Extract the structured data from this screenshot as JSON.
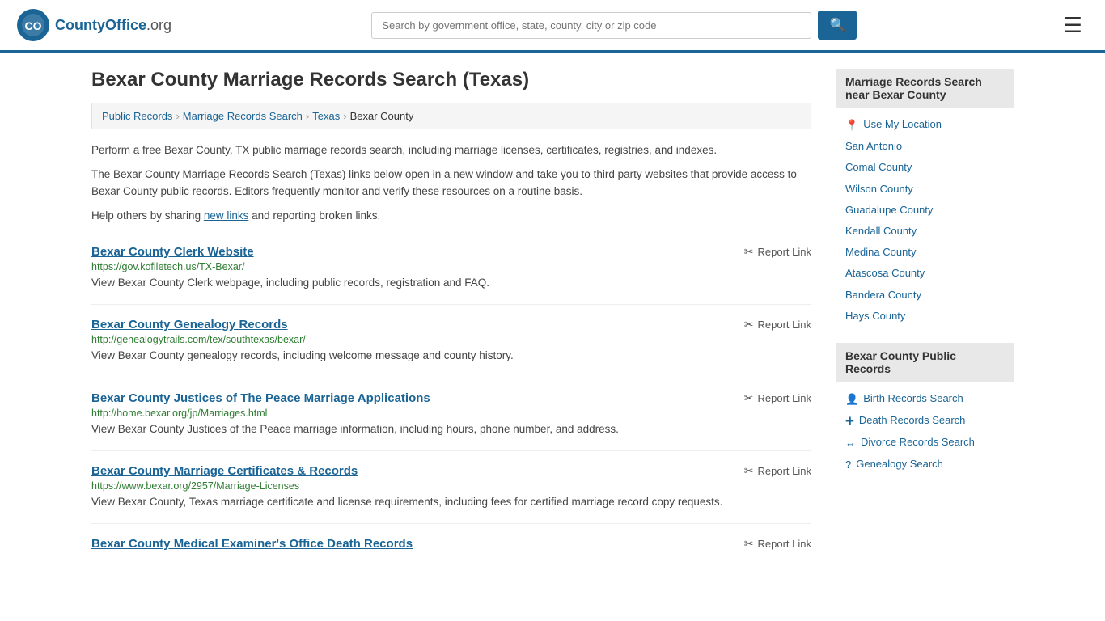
{
  "header": {
    "logo_text": "CountyOffice",
    "logo_org": ".org",
    "search_placeholder": "Search by government office, state, county, city or zip code",
    "search_btn_icon": "🔍"
  },
  "page": {
    "title": "Bexar County Marriage Records Search (Texas)"
  },
  "breadcrumb": {
    "items": [
      "Public Records",
      "Marriage Records Search",
      "Texas",
      "Bexar County"
    ]
  },
  "description": {
    "para1": "Perform a free Bexar County, TX public marriage records search, including marriage licenses, certificates, registries, and indexes.",
    "para2": "The Bexar County Marriage Records Search (Texas) links below open in a new window and take you to third party websites that provide access to Bexar County public records. Editors frequently monitor and verify these resources on a routine basis.",
    "para3_pre": "Help others by sharing ",
    "para3_link": "new links",
    "para3_post": " and reporting broken links."
  },
  "results": [
    {
      "title": "Bexar County Clerk Website",
      "url": "https://gov.kofiletech.us/TX-Bexar/",
      "desc": "View Bexar County Clerk webpage, including public records, registration and FAQ.",
      "report": "Report Link"
    },
    {
      "title": "Bexar County Genealogy Records",
      "url": "http://genealogytrails.com/tex/southtexas/bexar/",
      "desc": "View Bexar County genealogy records, including welcome message and county history.",
      "report": "Report Link"
    },
    {
      "title": "Bexar County Justices of The Peace Marriage Applications",
      "url": "http://home.bexar.org/jp/Marriages.html",
      "desc": "View Bexar County Justices of the Peace marriage information, including hours, phone number, and address.",
      "report": "Report Link"
    },
    {
      "title": "Bexar County Marriage Certificates & Records",
      "url": "https://www.bexar.org/2957/Marriage-Licenses",
      "desc": "View Bexar County, Texas marriage certificate and license requirements, including fees for certified marriage record copy requests.",
      "report": "Report Link"
    },
    {
      "title": "Bexar County Medical Examiner's Office Death Records",
      "url": "",
      "desc": "",
      "report": "Report Link"
    }
  ],
  "sidebar": {
    "nearby_title": "Marriage Records Search near Bexar County",
    "nearby_links": [
      {
        "icon": "📍",
        "label": "Use My Location"
      },
      {
        "icon": "",
        "label": "San Antonio"
      },
      {
        "icon": "",
        "label": "Comal County"
      },
      {
        "icon": "",
        "label": "Wilson County"
      },
      {
        "icon": "",
        "label": "Guadalupe County"
      },
      {
        "icon": "",
        "label": "Kendall County"
      },
      {
        "icon": "",
        "label": "Medina County"
      },
      {
        "icon": "",
        "label": "Atascosa County"
      },
      {
        "icon": "",
        "label": "Bandera County"
      },
      {
        "icon": "",
        "label": "Hays County"
      }
    ],
    "public_title": "Bexar County Public Records",
    "public_links": [
      {
        "icon": "👤",
        "label": "Birth Records Search"
      },
      {
        "icon": "✚",
        "label": "Death Records Search"
      },
      {
        "icon": "↔",
        "label": "Divorce Records Search"
      },
      {
        "icon": "?",
        "label": "Genealogy Search"
      }
    ]
  }
}
